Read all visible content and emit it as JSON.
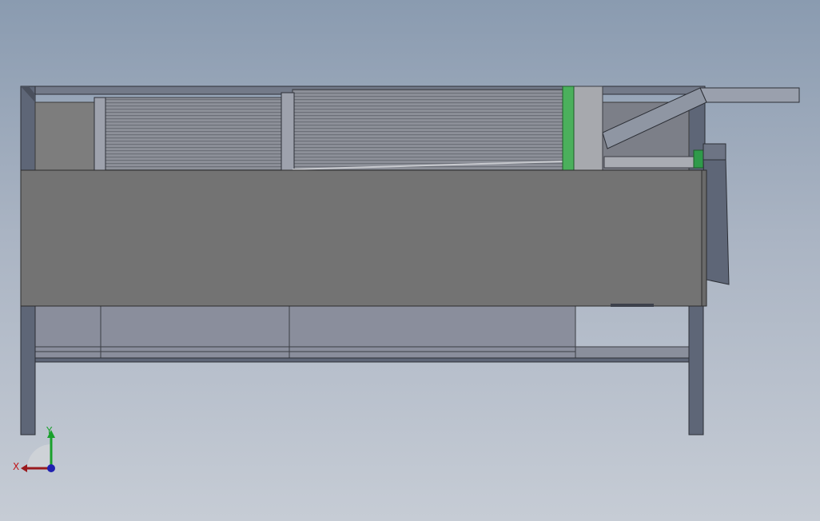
{
  "view": {
    "type": "cad-3d-viewport",
    "background_colors": [
      "#8a9bb0",
      "#c6ccd5"
    ]
  },
  "model": {
    "parts": [
      "frame",
      "rotary-drum-screen",
      "side-cover-panel",
      "support-legs",
      "discharge-chute",
      "drive-unit",
      "drum-ring-green"
    ],
    "colors": {
      "frame": "#5e6677",
      "panel": "#737373",
      "drum": "#888a92",
      "green_ring": "#4bb05c",
      "lower_tray": "#8a8e9c"
    }
  },
  "triad": {
    "x_label": "X",
    "y_label": "Y",
    "colors": {
      "x": "#c0161a",
      "y": "#19a02c",
      "z": "#2020b0"
    }
  }
}
